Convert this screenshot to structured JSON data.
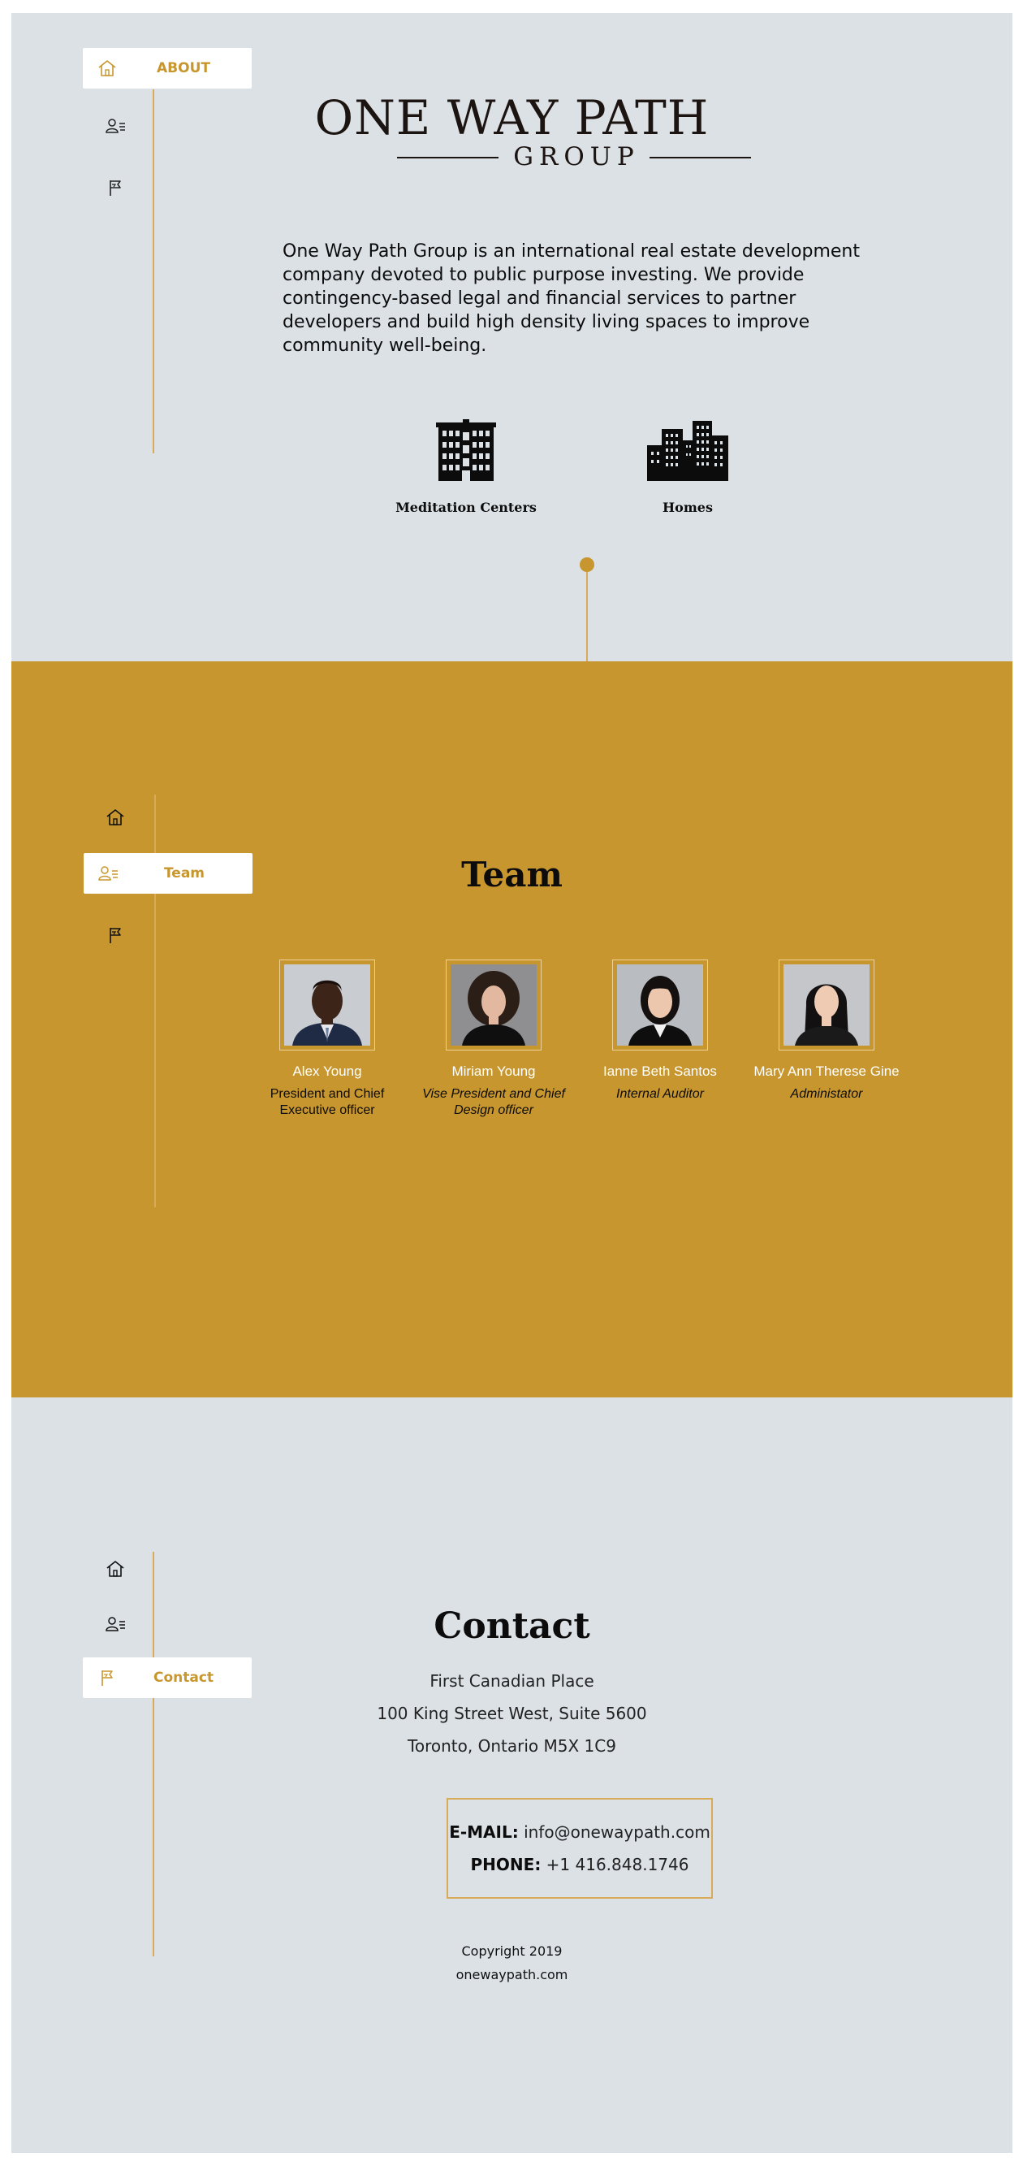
{
  "nav": {
    "about_label": "ABOUT",
    "team_label": "Team",
    "contact_label": "Contact",
    "icons": [
      "home-icon",
      "user-list-icon",
      "flag-icon"
    ]
  },
  "about": {
    "logo_line1": "ONE WAY PATH",
    "logo_line2": "GROUP",
    "description": "One Way Path Group is an international real estate development company devoted to public purpose investing. We provide contingency-based legal and financial services to partner developers and build high density living spaces to improve community well-being.",
    "services": [
      {
        "label": "Meditation Centers",
        "icon": "building-icon"
      },
      {
        "label": "Homes",
        "icon": "city-buildings-icon"
      }
    ]
  },
  "team": {
    "title": "Team",
    "members": [
      {
        "name": "Alex Young",
        "role": "President and Chief Executive officer"
      },
      {
        "name": "Miriam Young",
        "role": "Vise President and Chief Design officer"
      },
      {
        "name": "Ianne Beth Santos",
        "role": "Internal Auditor"
      },
      {
        "name": "Mary Ann Therese Gine",
        "role": "Administator"
      }
    ]
  },
  "contact": {
    "title": "Contact",
    "address": [
      "First Canadian Place",
      "100 King Street West, Suite 5600",
      "Toronto, Ontario M5X 1C9"
    ],
    "email_label": "E-MAIL:",
    "email": "info@onewaypath.com",
    "phone_label": "PHONE:",
    "phone": "+1 416.848.1746",
    "copyright": "Copyright 2019",
    "website": "onewaypath.com"
  },
  "colors": {
    "accent": "#c8962e",
    "light_bg": "#dce1e6",
    "line": "#d9aa57",
    "text": "#0c0c0c"
  }
}
